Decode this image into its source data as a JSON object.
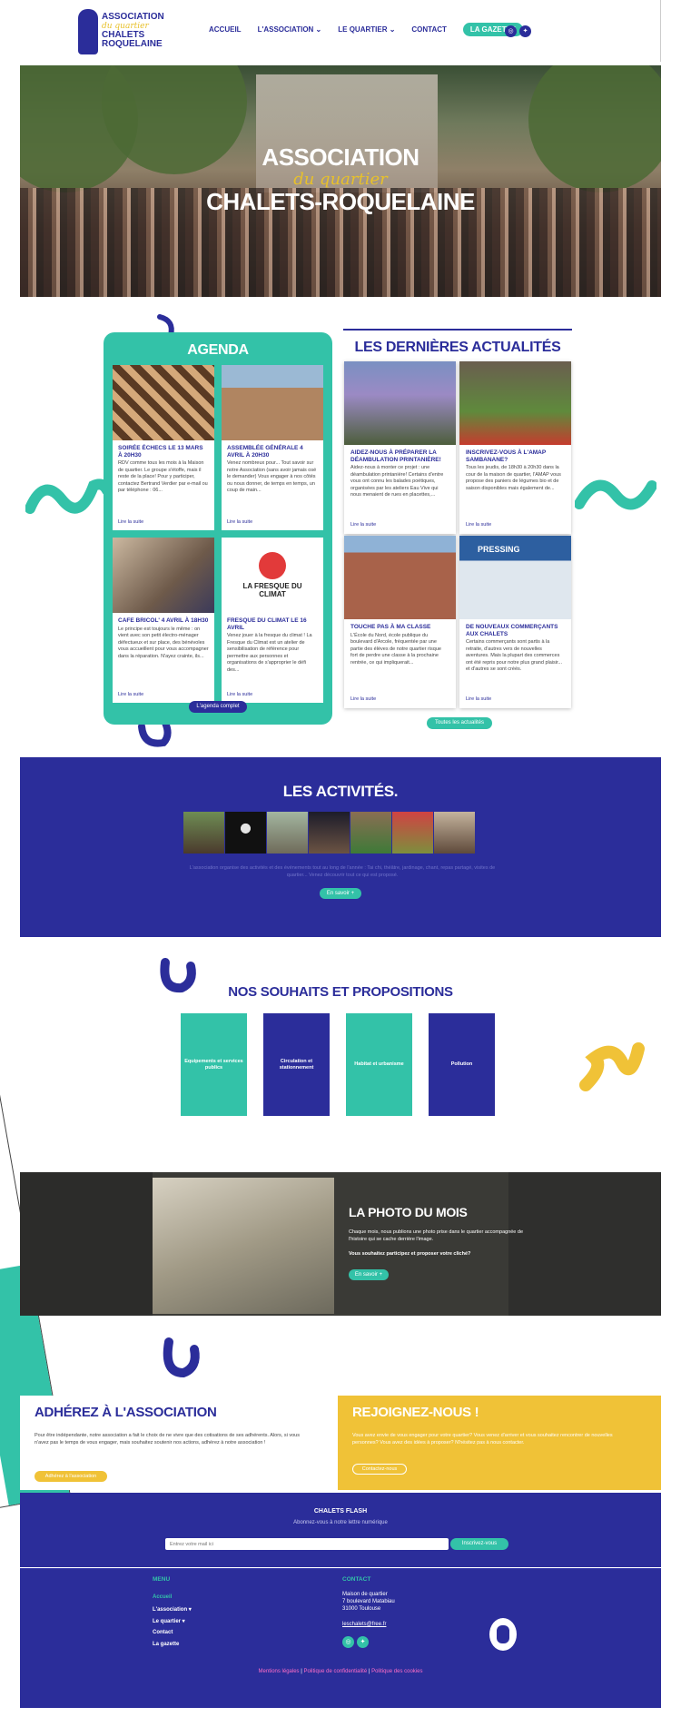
{
  "header": {
    "logo": {
      "line1": "ASSOCIATION",
      "line2": "du quartier",
      "line3": "CHALETS",
      "line4": "ROQUELAINE"
    },
    "nav": [
      {
        "label": "ACCUEIL"
      },
      {
        "label": "L'ASSOCIATION ⌄"
      },
      {
        "label": "LE QUARTIER ⌄"
      },
      {
        "label": "CONTACT"
      },
      {
        "label": "LA GAZETTE"
      }
    ],
    "socials": [
      "instagram-icon",
      "twitter-icon"
    ]
  },
  "hero": {
    "line1": "ASSOCIATION",
    "line2": "du quartier",
    "line3": "CHALETS-ROQUELAINE"
  },
  "agenda": {
    "title": "AGENDA",
    "cards": [
      {
        "title": "SOIRÉE ÉCHECS LE 13 MARS À 20H30",
        "text": "RDV comme tous les mois à la Maison de quartier. Le groupe s'étoffe, mais il reste de la place! Pour y participer, contactez Bertrand Verdier par e-mail ou par téléphone : 06...",
        "more": "Lire la suite"
      },
      {
        "title": "ASSEMBLÉE GÉNÉRALE 4 AVRIL À 20H30",
        "text": "Venez nombreux pour... Tout savoir sur notre Association (sans avoir jamais osé le demander) Vous engager à nos côtés ou nous donner, de temps en temps, un coup de main...",
        "more": "Lire la suite"
      },
      {
        "title": "CAFE BRICOL' 4 AVRIL À 18H30",
        "text": "Le principe est toujours le même : on vient avec son petit électro-ménager défectueux et sur place, des bénévoles vous accueillent pour vous accompagner dans la réparation. N'ayez crainte, ils...",
        "more": "Lire la suite"
      },
      {
        "title": "FRESQUE DU CLIMAT LE 16 AVRIL",
        "text": "Venez jouer à la fresque du climat ! La Fresque du Climat est un atelier de sensibilisation de référence pour permettre aux personnes et organisations de s'approprier le défi des...",
        "more": "Lire la suite",
        "logo": "LA FRESQUE DU CLIMAT"
      }
    ],
    "button": "L'agenda complet"
  },
  "news": {
    "title": "LES DERNIÈRES ACTUALITÉS",
    "cards": [
      {
        "title": "AIDEZ-NOUS À PRÉPARER LA DÉAMBULATION PRINTANIÈRE!",
        "text": "Aidez-nous à monter ce projet : une déambulation printanière! Certains d'entre vous ont connu les balades poétiques, organisées par les ateliers Eau Vive qui nous menaient de rues en placettes,...",
        "more": "Lire la suite"
      },
      {
        "title": "INSCRIVEZ-VOUS À L'AMAP SAMBANANE?",
        "text": "Tous les jeudis, de 18h30 à 20h30 dans la cour de la maison de quartier, l'AMAP vous propose des paniers de légumes bio et de saison disponibles mais également de...",
        "more": "Lire la suite"
      },
      {
        "title": "TOUCHE PAS À MA CLASSE",
        "text": "L'École du Nord, école publique du boulevard d'Arcole, fréquentée par une partie des élèves de notre quartier risque fort de perdre une classe à la prochaine rentrée, ce qui impliquerait...",
        "more": "Lire la suite"
      },
      {
        "title": "DE NOUVEAUX COMMERÇANTS AUX CHALETS",
        "text": "Certains commerçants sont partis à la retraite, d'autres vers de nouvelles aventures. Mais la plupart des commerces ont été repris pour notre plus grand plaisir... et d'autres se sont créés.",
        "more": "Lire la suite",
        "sign": "PRESSING"
      }
    ],
    "button": "Toutes les actualités"
  },
  "activites": {
    "title": "LES ACTIVITÉS.",
    "text": "L'association organise des activités et des événements tout au long de l'année : Tai chi, théâtre, jardinage, chant, repas partagé, visites de quartier... Venez découvrir tout ce qui est proposé.",
    "button": "En savoir +"
  },
  "souhaits": {
    "title": "NOS SOUHAITS ET PROPOSITIONS",
    "tiles": [
      "Equipements et services publics",
      "Circulation et stationnement",
      "Habitat et urbanisme",
      "Pollution"
    ]
  },
  "photo": {
    "title": "LA PHOTO DU MOIS",
    "text1": "Chaque mois, nous publions une photo prise dans le quartier accompagnée de l'histoire qui se cache derrière l'image.",
    "text2": "Vous souhaitez participez et proposer votre cliché?",
    "button": "En savoir +"
  },
  "adherez": {
    "title": "ADHÉREZ À L'ASSOCIATION",
    "text": "Pour être indépendante, notre association a fait le choix de ne vivre que des cotisations de ses adhérents. Alors, si vous n'avez pas le temps de vous engager, mais souhaitez soutenir nos actions, adhérez à notre association !",
    "button": "Adhérez à l'association"
  },
  "rejoignez": {
    "title": "REJOIGNEZ-NOUS !",
    "text": "Vous avez envie de vous engager pour votre quartier? Vous venez d'arriver et vous souhaitez rencontrer de nouvelles personnes? Vous avez des idées à proposer? N'hésitez pas à nous contacter.",
    "button": "Contactez-nous"
  },
  "flash": {
    "title": "CHALETS FLASH",
    "subtitle": "Abonnez-vous à notre lettre numérique",
    "placeholder": "Entrez votre mail ici",
    "button": "Inscrivez-vous"
  },
  "footer": {
    "menu_title": "MENU",
    "menu": [
      "Accueil",
      "L'association ▾",
      "Le quartier ▾",
      "Contact",
      "La gazette"
    ],
    "contact_title": "CONTACT",
    "address": [
      "Maison de quartier",
      "7 boulevard Matabiau",
      "31000 Toulouse"
    ],
    "email": "leschalets@free.fr",
    "legal": [
      "Mentions légales",
      "Politique de confidentialité",
      "Politique des cookies"
    ],
    "legal_sep": "|"
  },
  "colors": {
    "primary": "#2b2d9a",
    "teal": "#33c2a8",
    "yellow": "#f0c237"
  }
}
